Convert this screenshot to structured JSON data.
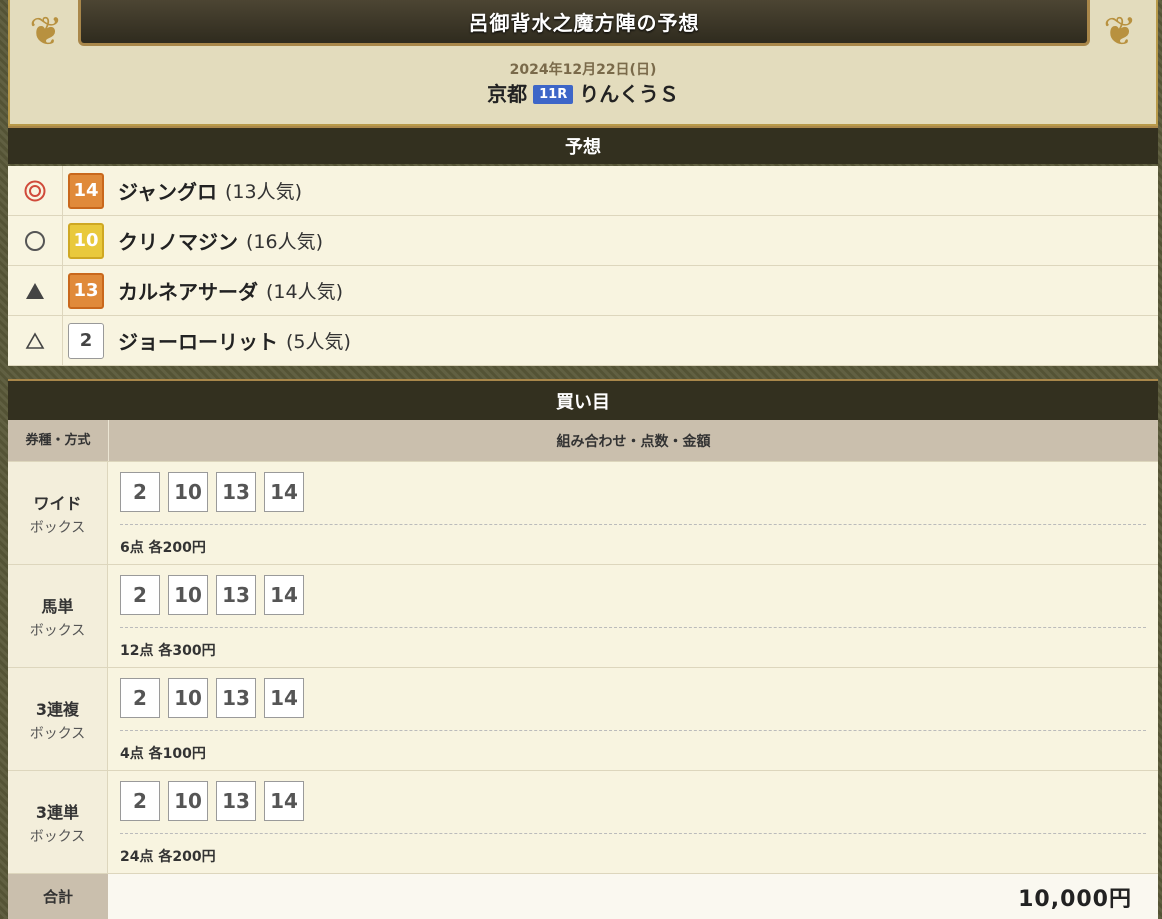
{
  "page": {
    "title": "呂御背水之魔方陣の予想"
  },
  "race": {
    "date": "2024年12月22日(日)",
    "venue": "京都",
    "race_no": "11R",
    "name": "りんくうＳ"
  },
  "prediction": {
    "section_title": "予想",
    "rows": [
      {
        "mark": "◎",
        "number": "14",
        "name": "ジャングロ",
        "popularity": "(13人気)",
        "color": "orange"
      },
      {
        "mark": "○",
        "number": "10",
        "name": "クリノマジン",
        "popularity": "(16人気)",
        "color": "yellow"
      },
      {
        "mark": "▲",
        "number": "13",
        "name": "カルネアサーダ",
        "popularity": "(14人気)",
        "color": "orange"
      },
      {
        "mark": "△",
        "number": "2",
        "name": "ジョーローリット",
        "popularity": "(5人気)",
        "color": "white"
      }
    ]
  },
  "bets": {
    "section_title": "買い目",
    "col_type": "券種・方式",
    "col_combo": "組み合わせ・点数・金額",
    "rows": [
      {
        "type": "ワイド",
        "method": "ボックス",
        "combo": [
          "2",
          "10",
          "13",
          "14"
        ],
        "points": "6点 各200円"
      },
      {
        "type": "馬単",
        "method": "ボックス",
        "combo": [
          "2",
          "10",
          "13",
          "14"
        ],
        "points": "12点 各300円"
      },
      {
        "type": "3連複",
        "method": "ボックス",
        "combo": [
          "2",
          "10",
          "13",
          "14"
        ],
        "points": "4点 各100円"
      },
      {
        "type": "3連単",
        "method": "ボックス",
        "combo": [
          "2",
          "10",
          "13",
          "14"
        ],
        "points": "24点 各200円"
      }
    ],
    "total_label": "合計",
    "total_value": "10,000円"
  }
}
